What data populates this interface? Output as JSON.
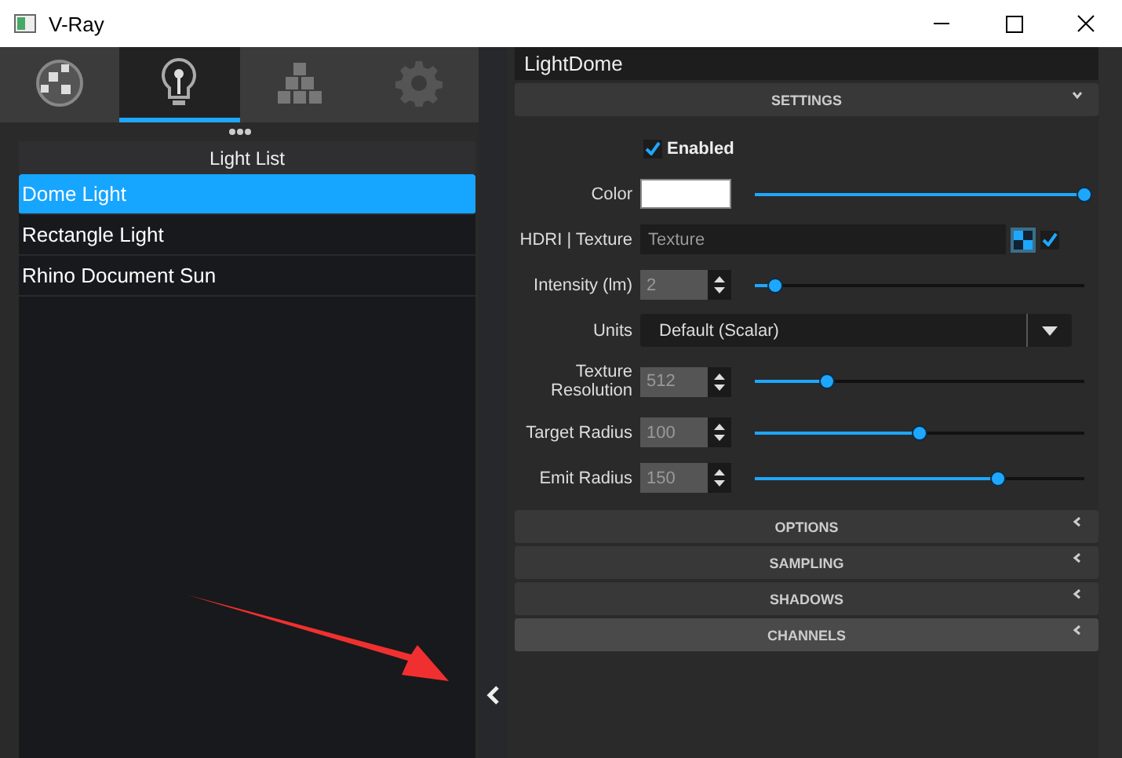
{
  "window": {
    "title": "V-Ray"
  },
  "tabs": [
    {
      "selected": false
    },
    {
      "selected": true
    },
    {
      "selected": false
    },
    {
      "selected": false
    }
  ],
  "light_list": {
    "header": "Light List",
    "items": [
      {
        "label": "Dome Light",
        "selected": true
      },
      {
        "label": "Rectangle Light",
        "selected": false
      },
      {
        "label": "Rhino Document Sun",
        "selected": false
      }
    ]
  },
  "panel": {
    "title": "LightDome",
    "sections": [
      {
        "label": "SETTINGS",
        "expanded": true,
        "hovered": false,
        "rows": [
          {
            "kind": "checkbox",
            "label": "Enabled",
            "checked": true
          },
          {
            "kind": "color",
            "label": "Color",
            "color": "#ffffff",
            "level": 1.0
          },
          {
            "kind": "texture",
            "label": "HDRI | Texture",
            "placeholder": "Texture",
            "checked": true
          },
          {
            "kind": "spinner",
            "label": "Intensity (lm)",
            "value": "2",
            "level": 0.06
          },
          {
            "kind": "dropdown",
            "label": "Units",
            "value": "Default (Scalar)"
          },
          {
            "kind": "spinner",
            "label": "Texture Resolution",
            "value": "512",
            "level": 0.22
          },
          {
            "kind": "spinner",
            "label": "Target Radius",
            "value": "100",
            "level": 0.5
          },
          {
            "kind": "spinner",
            "label": "Emit Radius",
            "value": "150",
            "level": 0.74
          }
        ]
      },
      {
        "label": "OPTIONS",
        "expanded": false,
        "hovered": false
      },
      {
        "label": "SAMPLING",
        "expanded": false,
        "hovered": false
      },
      {
        "label": "SHADOWS",
        "expanded": false,
        "hovered": false
      },
      {
        "label": "CHANNELS",
        "expanded": false,
        "hovered": true
      }
    ]
  }
}
